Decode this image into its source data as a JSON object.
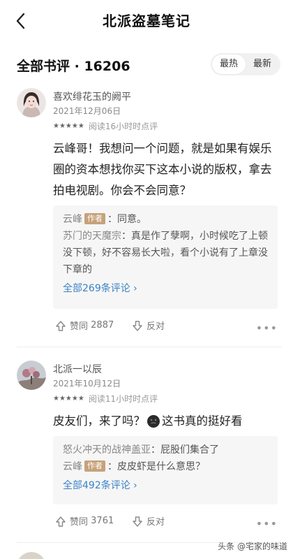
{
  "header": {
    "title": "北派盗墓笔记"
  },
  "section": {
    "title": "全部书评 · 16206",
    "sort_hot": "最热",
    "sort_new": "最新"
  },
  "comments": [
    {
      "username": "喜欢绯花玉的阙平",
      "date": "2021年12月06日",
      "stars": "★★★★★",
      "rating": 5,
      "read_time": "阅读16小时时点评",
      "content": "云峰哥！我想问一个问题，就是如果有娱乐圈的资本想找你买下这本小说的版权，拿去拍电视剧。你会不会同意？",
      "replies": [
        {
          "name": "云峰",
          "tag": "作者",
          "text": "：同意。"
        },
        {
          "name": "苏门的天魔宗",
          "tag": "",
          "text": "：真是作了孽啊，小时候吃了上顿没下顿，好不容易长大啦，看个小说有了上章没下章的"
        }
      ],
      "all_replies": "全部269条评论 ›",
      "like_label": "赞同",
      "like_count": "2887",
      "dislike_label": "反对"
    },
    {
      "username": "北派一以辰",
      "date": "2021年10月12日",
      "stars": "★★★★★",
      "rating": 5,
      "read_time": "阅读11小时时点评",
      "content_a": "皮友们，来了吗？",
      "content_b": "这书真的挺好看",
      "replies": [
        {
          "name": "怒火冲天的战神盖亚",
          "tag": "",
          "text": "：屁股们集合了"
        },
        {
          "name": "云峰",
          "tag": "作者",
          "text": "：皮皮虾是什么意思？"
        }
      ],
      "all_replies": "全部492条评论 ›",
      "like_label": "赞同",
      "like_count": "3761",
      "dislike_label": "反对"
    }
  ],
  "watermark": "头条 @宅家的味道",
  "colors": {
    "author_tag": "#c6a27a",
    "link": "#3b82c8"
  }
}
